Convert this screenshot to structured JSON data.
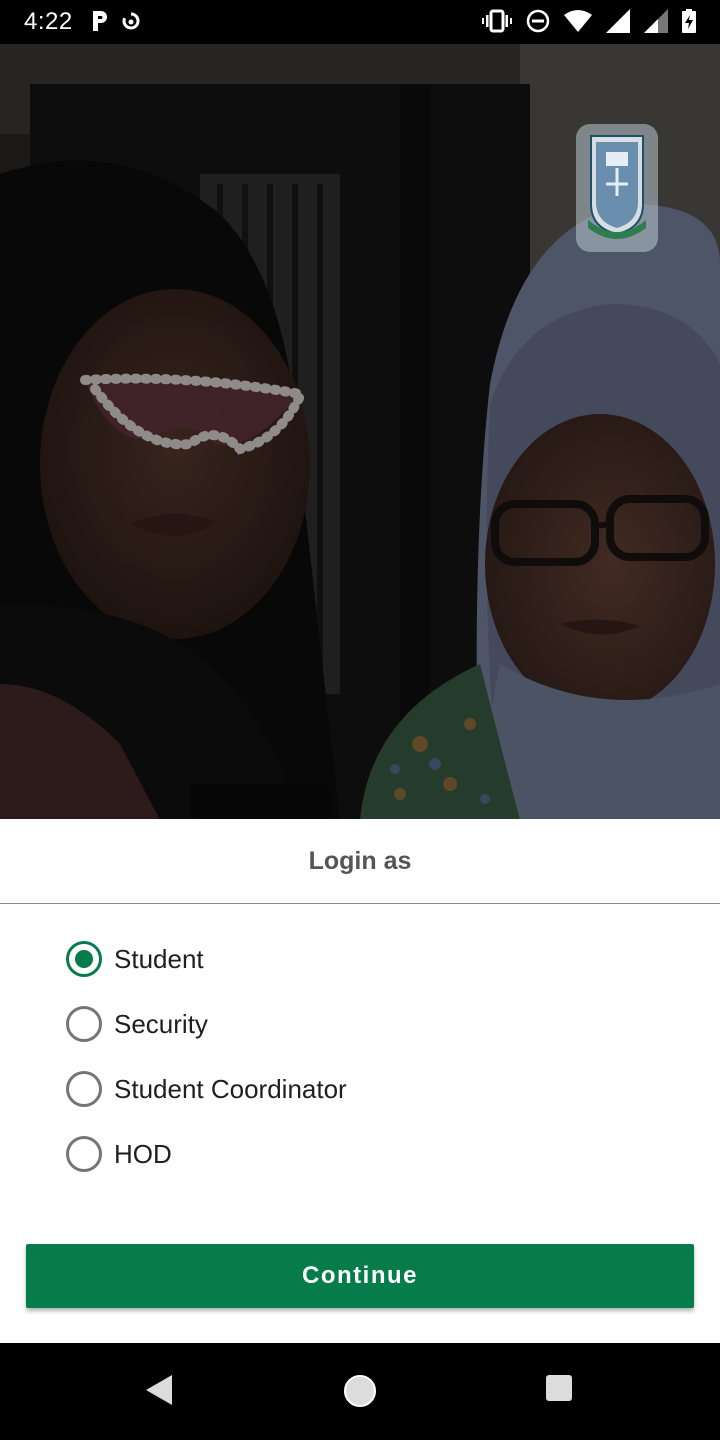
{
  "status_bar": {
    "time": "4:22",
    "left_icons": [
      "parking-app-icon",
      "sync-icon"
    ],
    "right_icons": [
      "vibrate-icon",
      "do-not-disturb-icon",
      "wifi-icon",
      "cell-signal-icon",
      "cell-signal-2-icon",
      "battery-charging-icon"
    ]
  },
  "hero": {
    "logo": "school-crest-logo"
  },
  "login_sheet": {
    "title": "Login as",
    "options": [
      {
        "label": "Student",
        "selected": true
      },
      {
        "label": "Security",
        "selected": false
      },
      {
        "label": "Student Coordinator",
        "selected": false
      },
      {
        "label": "HOD",
        "selected": false
      }
    ],
    "continue_label": "Continue"
  },
  "colors": {
    "accent": "#067c4b",
    "radio_unchecked": "#757575",
    "title_text": "#555555"
  },
  "nav_bar": {
    "buttons": [
      "back-icon",
      "home-icon",
      "recents-icon"
    ]
  }
}
